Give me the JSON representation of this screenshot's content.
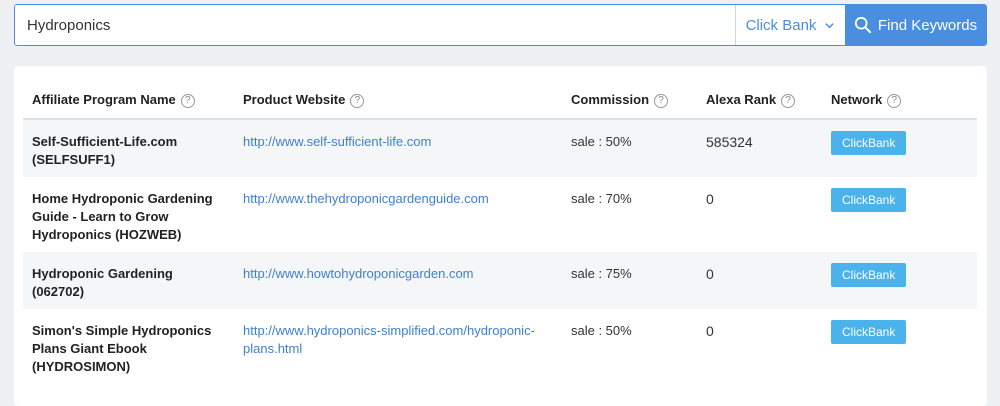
{
  "search": {
    "value": "Hydroponics",
    "network_selected": "Click Bank",
    "button_label": "Find Keywords"
  },
  "table": {
    "headers": [
      {
        "label": "Affiliate Program Name"
      },
      {
        "label": "Product Website"
      },
      {
        "label": "Commission"
      },
      {
        "label": "Alexa Rank"
      },
      {
        "label": "Network"
      }
    ],
    "rows": [
      {
        "name": "Self-Sufficient-Life.com (SELFSUFF1)",
        "website": "http://www.self-sufficient-life.com",
        "commission": "sale : 50%",
        "alexa": "585324",
        "network": "ClickBank"
      },
      {
        "name": "Home Hydroponic Gardening Guide - Learn to Grow Hydroponics (HOZWEB)",
        "website": "http://www.thehydroponicgardenguide.com",
        "commission": "sale : 70%",
        "alexa": "0",
        "network": "ClickBank"
      },
      {
        "name": "Hydroponic Gardening (062702)",
        "website": "http://www.howtohydroponicgarden.com",
        "commission": "sale : 75%",
        "alexa": "0",
        "network": "ClickBank"
      },
      {
        "name": "Simon's Simple Hydroponics Plans Giant Ebook (HYDROSIMON)",
        "website": "http://www.hydroponics-simplified.com/hydroponic-plans.html",
        "commission": "sale : 50%",
        "alexa": "0",
        "network": "ClickBank"
      }
    ]
  },
  "colors": {
    "accent": "#4a8ee0",
    "network_badge": "#4ab3ec",
    "link": "#3f7fd1"
  }
}
